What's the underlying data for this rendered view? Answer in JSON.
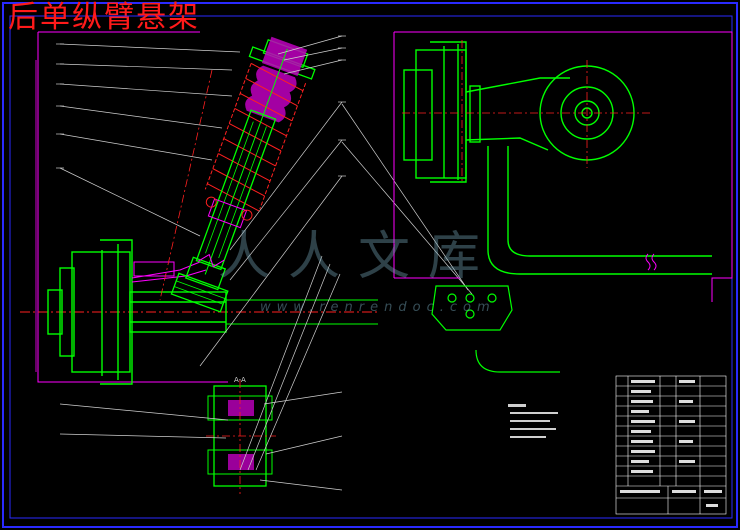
{
  "drawing": {
    "title": "后单纵臂悬架",
    "watermark_text": "人人文库",
    "watermark_url": "www.renrendoc.com",
    "section_label": "A-A",
    "colors": {
      "background": "#000000",
      "frame": "#2a2aff",
      "outline": "#00ff00",
      "annotation": "#ff00ff",
      "centerline": "#ff2020",
      "leader": "#d0d0d0",
      "title": "#ff1a1a"
    }
  }
}
